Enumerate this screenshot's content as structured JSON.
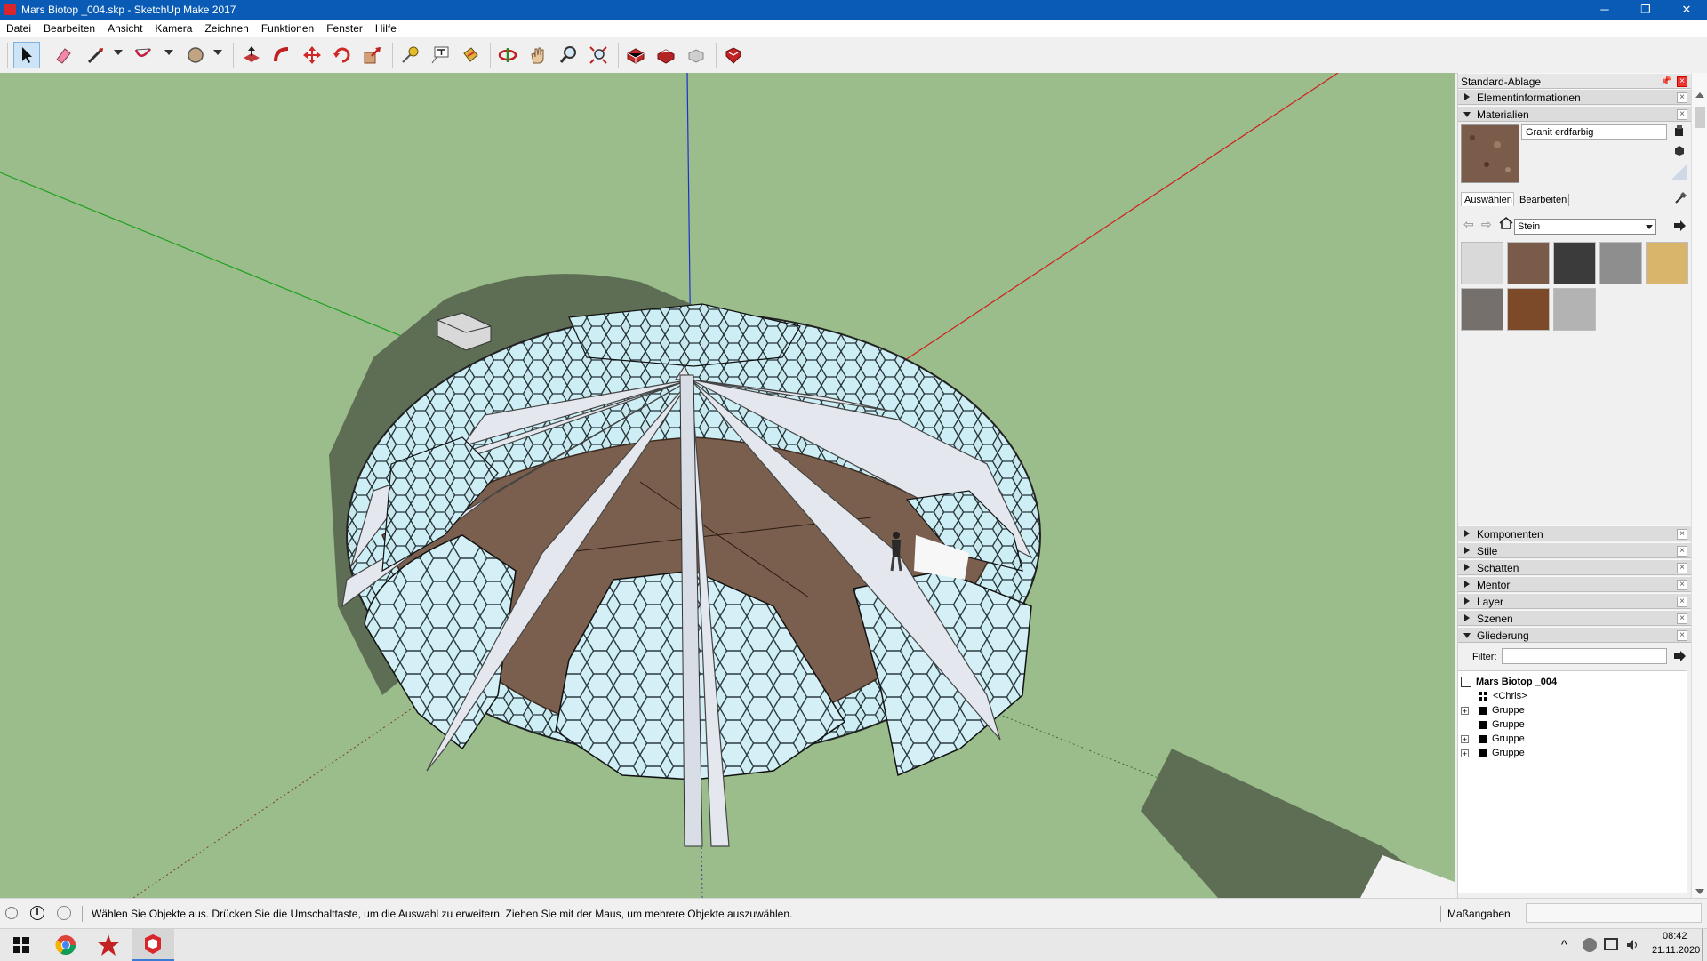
{
  "window": {
    "title": "Mars Biotop _004.skp - SketchUp Make 2017",
    "min_glyph": "─",
    "max_glyph": "❐",
    "close_glyph": "✕"
  },
  "menu": [
    "Datei",
    "Bearbeiten",
    "Ansicht",
    "Kamera",
    "Zeichnen",
    "Funktionen",
    "Fenster",
    "Hilfe"
  ],
  "toolbar": {
    "tools": [
      "select-tool-icon",
      "eraser-tool-icon",
      "line-tool-icon",
      "arc-tool-icon",
      "circle-tool-icon",
      "push-pull-tool-icon",
      "follow-me-tool-icon",
      "move-tool-icon",
      "rotate-tool-icon",
      "scale-tool-icon",
      "tape-measure-tool-icon",
      "text-tool-icon",
      "paint-bucket-tool-icon",
      "orbit-tool-icon",
      "pan-tool-icon",
      "zoom-tool-icon",
      "zoom-extents-tool-icon",
      "3d-warehouse-icon",
      "extension-warehouse-icon",
      "layout-icon",
      "extension-manager-icon"
    ]
  },
  "panel": {
    "tray_title": "Standard-Ablage",
    "element_info": "Elementinformationen",
    "materials": {
      "header": "Materialien",
      "material_name": "Granit erdfarbig",
      "tab_select": "Auswählen",
      "tab_edit": "Bearbeiten",
      "library": "Stein",
      "swatch_colors": [
        "#d9d9d9",
        "#7a5a48",
        "#3b3b3b",
        "#8e8e8e",
        "#d8b56a",
        "#75706c",
        "#7c4a28",
        "#b3b3b3"
      ],
      "preview_color": "#7b5c4a"
    },
    "collapsed": [
      "Komponenten",
      "Stile",
      "Schatten",
      "Mentor",
      "Layer",
      "Szenen"
    ],
    "outliner": {
      "header": "Gliederung",
      "filter_label": "Filter:",
      "filter_value": "",
      "root": "Mars Biotop _004",
      "items": [
        {
          "label": "<Chris>",
          "expandable": false,
          "icon": "component-icon"
        },
        {
          "label": "Gruppe",
          "expandable": true,
          "icon": "group-icon"
        },
        {
          "label": "Gruppe",
          "expandable": false,
          "icon": "group-icon"
        },
        {
          "label": "Gruppe",
          "expandable": true,
          "icon": "group-icon"
        },
        {
          "label": "Gruppe",
          "expandable": true,
          "icon": "group-icon"
        }
      ]
    }
  },
  "status": {
    "hint": "Wählen Sie Objekte aus. Drücken Sie die Umschalttaste, um die Auswahl zu erweitern. Ziehen Sie mit der Maus, um mehrere Objekte auszuwählen.",
    "measurements_label": "Maßangaben",
    "measurements_value": ""
  },
  "taskbar": {
    "time": "08:42",
    "date": "21.11.2020",
    "tray_up": "^"
  },
  "colors": {
    "titlebar": "#0a5bb5",
    "viewport": "#9abd8b",
    "ground_shadow": "#5e6e54",
    "floor": "#7a5f4e",
    "glass": "#cfeef4",
    "panel_fin": "#e4e7ee",
    "axis_red": "#d02020",
    "axis_green": "#1fa01f",
    "axis_blue": "#1f2fcf"
  }
}
